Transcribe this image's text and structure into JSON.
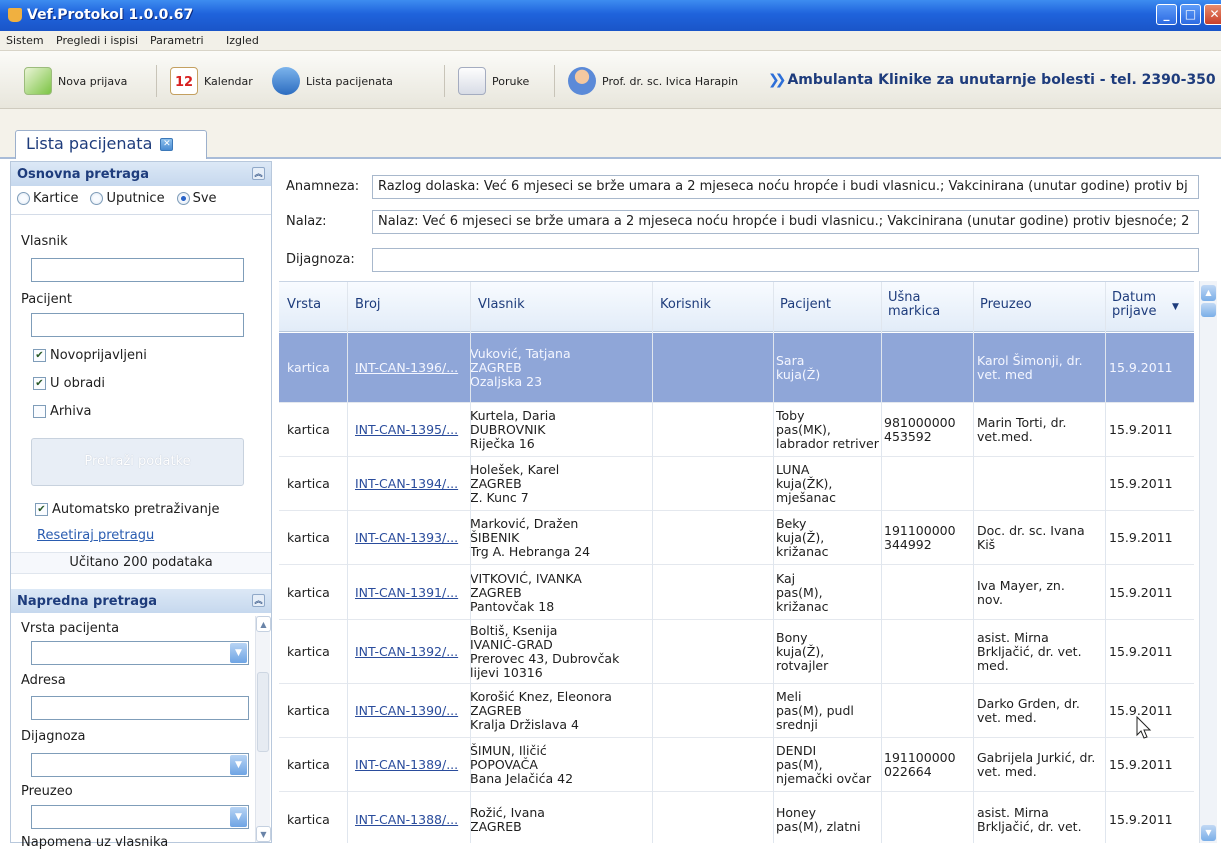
{
  "window": {
    "title": "Vef.Protokol 1.0.0.67"
  },
  "menu": [
    "Sistem",
    "Pregledi i ispisi",
    "Parametri",
    "Izgled"
  ],
  "toolbar": {
    "nova_prijava": "Nova prijava",
    "kalendar": "Kalendar",
    "kalendar_day": "12",
    "lista": "Lista pacijenata",
    "poruke": "Poruke",
    "user": "Prof. dr. sc. Ivica Harapin",
    "ambulanta": "Ambulanta Klinike za unutarnje bolesti - tel. 2390-350"
  },
  "tab": {
    "label": "Lista pacijenata"
  },
  "osnovna": {
    "header": "Osnovna pretraga",
    "radios": [
      "Kartice",
      "Uputnice",
      "Sve"
    ],
    "selected": "Sve",
    "vlasnik_label": "Vlasnik",
    "vlasnik_value": "",
    "pacijent_label": "Pacijent",
    "pacijent_value": "",
    "checks": [
      {
        "label": "Novoprijavljeni",
        "checked": true
      },
      {
        "label": "U obradi",
        "checked": true
      },
      {
        "label": "Arhiva",
        "checked": false
      }
    ],
    "search_button": "Pretraži podatke",
    "auto_label": "Automatsko pretraživanje",
    "auto_checked": true,
    "reset_link": "Resetiraj pretragu",
    "loaded": "Učitano 200 podataka"
  },
  "napredna": {
    "header": "Napredna pretraga",
    "fields": [
      "Vrsta pacijenta",
      "Adresa",
      "Dijagnoza",
      "Preuzeo",
      "Napomena uz vlasnika"
    ]
  },
  "details": {
    "anamneza_label": "Anamneza:",
    "anamneza": "Razlog dolaska: Već 6 mjeseci se brže umara a 2 mjeseca noću hropće i budi vlasnicu.; Vakcinirana (unutar godine) protiv bj",
    "nalaz_label": "Nalaz:",
    "nalaz": "Nalaz: Već 6 mjeseci se brže umara a 2 mjeseca noću hropće i budi vlasnicu.; Vakcinirana (unutar godine) protiv bjesnoće; 2",
    "dijagnoza_label": "Dijagnoza:",
    "dijagnoza": ""
  },
  "grid": {
    "columns": [
      "Vrsta",
      "Broj",
      "Vlasnik",
      "Korisnik",
      "Pacijent",
      "Ušna markica",
      "Preuzeo",
      "Datum prijave"
    ],
    "rows": [
      {
        "vrsta": "kartica",
        "broj": "INT-CAN-1396/...",
        "vlasnik": [
          "Vuković, Tatjana",
          "ZAGREB",
          "Ozaljska 23"
        ],
        "korisnik": "",
        "pacijent": [
          "Sara",
          "kuja(Ž)"
        ],
        "markica": [],
        "preuzeo": [
          "Karol Šimonji, dr.",
          "vet. med"
        ],
        "datum": "15.9.2011"
      },
      {
        "vrsta": "kartica",
        "broj": "INT-CAN-1395/...",
        "vlasnik": [
          "Kurtela, Daria",
          "DUBROVNIK",
          "Riječka 16"
        ],
        "korisnik": "",
        "pacijent": [
          "Toby",
          "pas(MK),",
          "labrador retriver"
        ],
        "markica": [
          "981000000",
          "453592"
        ],
        "preuzeo": [
          "Marin Torti, dr.",
          "vet.med."
        ],
        "datum": "15.9.2011"
      },
      {
        "vrsta": "kartica",
        "broj": "INT-CAN-1394/...",
        "vlasnik": [
          "Holešek, Karel",
          "ZAGREB",
          "Z. Kunc 7"
        ],
        "korisnik": "",
        "pacijent": [
          "LUNA",
          "kuja(ŽK),",
          "mješanac"
        ],
        "markica": [],
        "preuzeo": [],
        "datum": "15.9.2011"
      },
      {
        "vrsta": "kartica",
        "broj": "INT-CAN-1393/...",
        "vlasnik": [
          "Marković, Dražen",
          "ŠIBENIK",
          "Trg A. Hebranga 24"
        ],
        "korisnik": "",
        "pacijent": [
          "Beky",
          "kuja(Ž),",
          "križanac"
        ],
        "markica": [
          "191100000",
          "344992"
        ],
        "preuzeo": [
          "Doc. dr. sc. Ivana",
          "Kiš"
        ],
        "datum": "15.9.2011"
      },
      {
        "vrsta": "kartica",
        "broj": "INT-CAN-1391/...",
        "vlasnik": [
          "VITKOVIĆ, IVANKA",
          "ZAGREB",
          "Pantovčak 18"
        ],
        "korisnik": "",
        "pacijent": [
          "Kaj",
          "pas(M),",
          "križanac"
        ],
        "markica": [],
        "preuzeo": [
          "Iva Mayer, zn.",
          "nov."
        ],
        "datum": "15.9.2011"
      },
      {
        "vrsta": "kartica",
        "broj": "INT-CAN-1392/...",
        "vlasnik": [
          "Boltiš, Ksenija",
          "IVANIĆ-GRAD",
          "Prerovec 43, Dubrovčak",
          "lijevi 10316"
        ],
        "korisnik": "",
        "pacijent": [
          "Bony",
          "kuja(Ž),",
          "rotvajler"
        ],
        "markica": [],
        "preuzeo": [
          "asist. Mirna",
          "Brkljačić, dr. vet.",
          "med."
        ],
        "datum": "15.9.2011"
      },
      {
        "vrsta": "kartica",
        "broj": "INT-CAN-1390/...",
        "vlasnik": [
          "Korošić Knez, Eleonora",
          "ZAGREB",
          "Kralja Držislava 4"
        ],
        "korisnik": "",
        "pacijent": [
          "Meli",
          "pas(M), pudl",
          "srednji"
        ],
        "markica": [],
        "preuzeo": [
          "Darko Grden, dr.",
          "vet. med."
        ],
        "datum": "15.9.2011"
      },
      {
        "vrsta": "kartica",
        "broj": "INT-CAN-1389/...",
        "vlasnik": [
          "ŠIMUN, Iličić",
          "POPOVAČA",
          "Bana Jelačića 42"
        ],
        "korisnik": "",
        "pacijent": [
          "DENDI",
          "pas(M),",
          "njemački ovčar"
        ],
        "markica": [
          "191100000",
          "022664"
        ],
        "preuzeo": [
          "Gabrijela Jurkić, dr.",
          "vet. med."
        ],
        "datum": "15.9.2011"
      },
      {
        "vrsta": "kartica",
        "broj": "INT-CAN-1388/...",
        "vlasnik": [
          "Rožić, Ivana",
          "ZAGREB"
        ],
        "korisnik": "",
        "pacijent": [
          "Honey",
          "pas(M), zlatni"
        ],
        "markica": [],
        "preuzeo": [
          "asist. Mirna",
          "Brkljačić, dr. vet."
        ],
        "datum": "15.9.2011"
      }
    ]
  }
}
